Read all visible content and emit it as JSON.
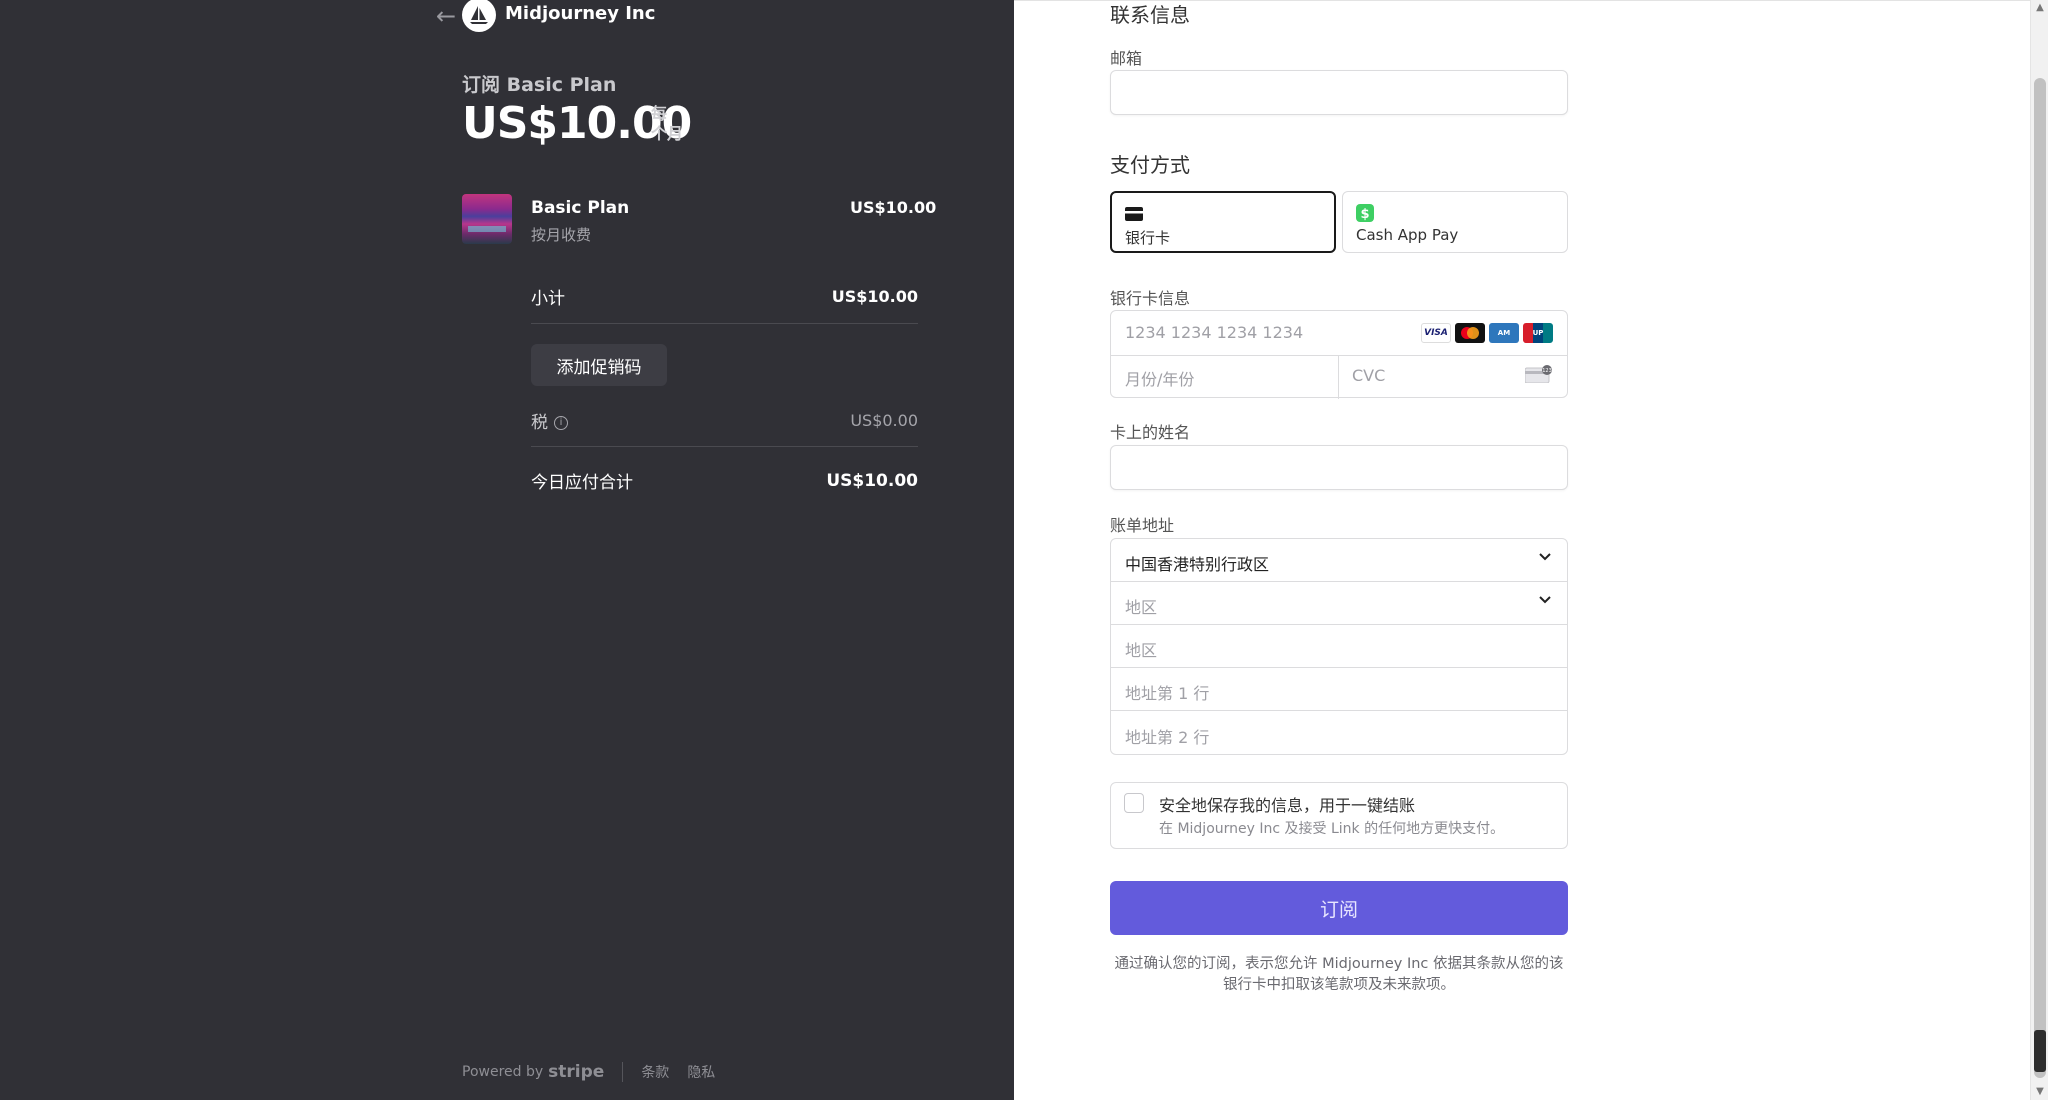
{
  "merchant": {
    "name": "Midjourney Inc"
  },
  "summary": {
    "subscribe_label": "订阅 Basic Plan",
    "price": "US$10.00",
    "period_line1": "每",
    "period_line2": "个月",
    "item_name": "Basic Plan",
    "item_sub": "按月收费",
    "item_price": "US$10.00",
    "subtotal_label": "小计",
    "subtotal_value": "US$10.00",
    "promo_label": "添加促销码",
    "tax_label": "税",
    "tax_value": "US$0.00",
    "total_label": "今日应付合计",
    "total_value": "US$10.00"
  },
  "footer": {
    "powered": "Powered by",
    "brand": "stripe",
    "terms": "条款",
    "privacy": "隐私"
  },
  "form": {
    "contact_title": "联系信息",
    "email_label": "邮箱",
    "payment_title": "支付方式",
    "method_card": "银行卡",
    "method_cashapp": "Cash App Pay",
    "card_info_label": "银行卡信息",
    "card_number_placeholder": "1234 1234 1234 1234",
    "expiry_placeholder": "月份/年份",
    "cvc_placeholder": "CVC",
    "cardholder_label": "卡上的姓名",
    "billing_label": "账单地址",
    "country_value": "中国香港特别行政区",
    "region_select_placeholder": "地区",
    "region_input_placeholder": "地区",
    "address1_placeholder": "地址第 1 行",
    "address2_placeholder": "地址第 2 行",
    "save_title": "安全地保存我的信息，用于一键结账",
    "save_sub": "在 Midjourney Inc 及接受 Link 的任何地方更快支付。",
    "subscribe_button": "订阅",
    "terms_text": "通过确认您的订阅，表示您允许 Midjourney Inc 依据其条款从您的该银行卡中扣取该笔款项及未来款项。"
  },
  "brands": [
    "VISA",
    "mastercard",
    "amex",
    "unionpay"
  ],
  "colors": {
    "left_bg": "#303036",
    "accent": "#635bdc",
    "cashapp": "#3ecf63"
  }
}
